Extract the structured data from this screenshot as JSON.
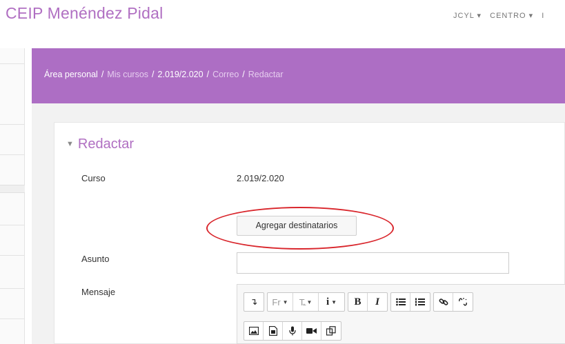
{
  "site": {
    "title": "CEIP Menéndez Pidal"
  },
  "topnav": {
    "items": [
      "JCYL ▾",
      "CENTRO ▾",
      "I"
    ]
  },
  "breadcrumb": {
    "items": [
      "Área personal",
      "Mis cursos",
      "2.019/2.020",
      "Correo",
      "Redactar"
    ],
    "separator": "/"
  },
  "form": {
    "section_title": "Redactar",
    "course_label": "Curso",
    "course_value": "2.019/2.020",
    "add_recipients_label": "Agregar destinatarios",
    "subject_label": "Asunto",
    "subject_value": "",
    "message_label": "Mensaje"
  },
  "editor": {
    "toolbar_row1": [
      [
        "↴"
      ],
      [
        "Fr",
        "T꜡",
        "i"
      ],
      [
        "B",
        "I"
      ],
      [
        "bullet-list-icon",
        "numbered-list-icon"
      ],
      [
        "link-icon",
        "unlink-icon"
      ]
    ],
    "toolbar_row2": [
      "image-icon",
      "media-icon",
      "microphone-icon",
      "video-icon",
      "copy-icon"
    ]
  },
  "colors": {
    "accent": "#b06fc2",
    "banner": "#ad6ec4",
    "annotation": "#d9262c"
  }
}
